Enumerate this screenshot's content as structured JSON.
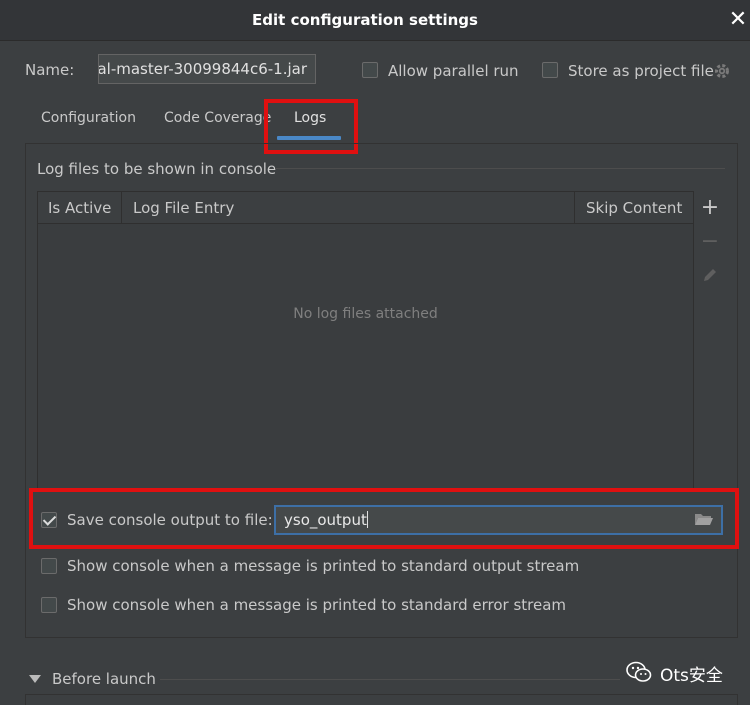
{
  "dialog": {
    "title": "Edit configuration settings"
  },
  "header": {
    "name_label": "Name:",
    "name_value": "al-master-30099844c6-1.jar",
    "allow_parallel_run": {
      "label": "Allow parallel run",
      "checked": false
    },
    "store_as_project_file": {
      "label": "Store as project file",
      "checked": false
    }
  },
  "tabs": [
    {
      "label": "Configuration",
      "active": false
    },
    {
      "label": "Code Coverage",
      "active": false
    },
    {
      "label": "Logs",
      "active": true
    }
  ],
  "logs": {
    "section_title": "Log files to be shown in console",
    "columns": [
      "Is Active",
      "Log File Entry",
      "Skip Content"
    ],
    "rows": [],
    "empty_text": "No log files attached",
    "toolbar_icons": [
      "plus-icon",
      "minus-icon",
      "pencil-icon"
    ]
  },
  "save_console": {
    "label": "Save console output to file:",
    "checked": true,
    "value": "yso_output"
  },
  "show_console_stdout": {
    "label": "Show console when a message is printed to standard output stream",
    "checked": false
  },
  "show_console_stderr": {
    "label": "Show console when a message is printed to standard error stream",
    "checked": false
  },
  "before_launch": {
    "label": "Before launch"
  },
  "watermark": {
    "text": "Ots安全"
  },
  "colors": {
    "accent": "#4a88c7",
    "highlight": "#e01010",
    "background": "#3c3f41"
  }
}
